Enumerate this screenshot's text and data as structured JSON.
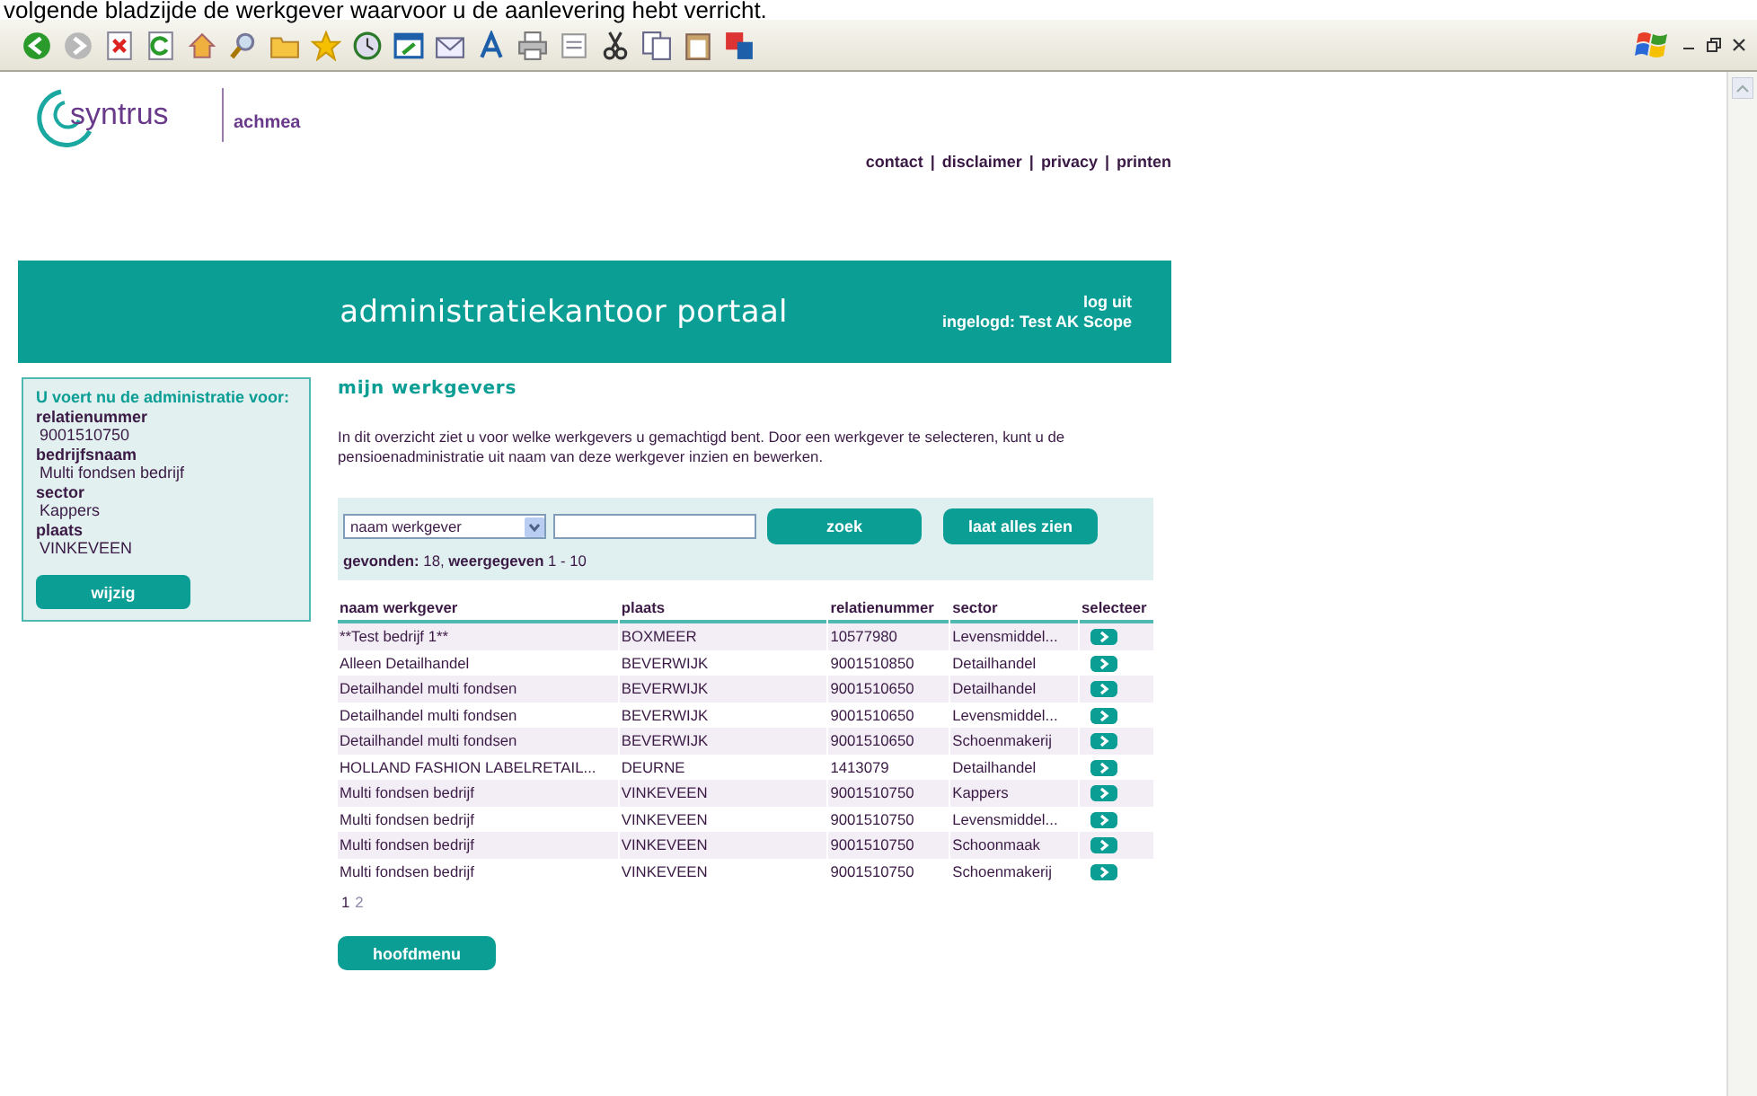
{
  "caption": "volgende bladzijde de werkgever waarvoor u de aanlevering hebt verricht.",
  "header": {
    "logo": {
      "name": "syntrus",
      "partner": "achmea"
    },
    "links": [
      "contact",
      "disclaimer",
      "privacy",
      "printen"
    ],
    "separator": "|"
  },
  "banner": {
    "title": "administratiekantoor portaal",
    "logout": "log uit",
    "logged_in": "ingelogd: Test AK Scope"
  },
  "sidebar": {
    "heading": "U voert nu de administratie voor:",
    "fields": [
      {
        "label": "relatienummer",
        "value": "9001510750"
      },
      {
        "label": "bedrijfsnaam",
        "value": "Multi fondsen bedrijf"
      },
      {
        "label": "sector",
        "value": "Kappers"
      },
      {
        "label": "plaats",
        "value": "VINKEVEEN"
      }
    ],
    "button": "wijzig"
  },
  "main": {
    "title": "mijn werkgevers",
    "intro": "In dit overzicht ziet u voor welke werkgevers u gemachtigd bent. Door een werkgever te selecteren, kunt u de pensioenadministratie uit naam van deze werkgever inzien en bewerken.",
    "search": {
      "field_select": "naam werkgever",
      "search_button": "zoek",
      "show_all_button": "laat alles zien",
      "result": "**gevonden:** 18, **weergegeven** 1 - 10"
    },
    "table": {
      "columns": [
        "naam werkgever",
        "plaats",
        "relatienummer",
        "sector",
        "selecteer"
      ],
      "rows": [
        [
          "**Test bedrijf 1**",
          "BOXMEER",
          "10577980",
          "Levensmiddel..."
        ],
        [
          "Alleen Detailhandel",
          "BEVERWIJK",
          "9001510850",
          "Detailhandel"
        ],
        [
          "Detailhandel multi fondsen",
          "BEVERWIJK",
          "9001510650",
          "Detailhandel"
        ],
        [
          "Detailhandel multi fondsen",
          "BEVERWIJK",
          "9001510650",
          "Levensmiddel..."
        ],
        [
          "Detailhandel multi fondsen",
          "BEVERWIJK",
          "9001510650",
          "Schoenmakerij"
        ],
        [
          "HOLLAND FASHION LABELRETAIL...",
          "DEURNE",
          "1413079",
          "Detailhandel"
        ],
        [
          "Multi fondsen bedrijf",
          "VINKEVEEN",
          "9001510750",
          "Kappers"
        ],
        [
          "Multi fondsen bedrijf",
          "VINKEVEEN",
          "9001510750",
          "Levensmiddel..."
        ],
        [
          "Multi fondsen bedrijf",
          "VINKEVEEN",
          "9001510750",
          "Schoonmaak"
        ],
        [
          "Multi fondsen bedrijf",
          "VINKEVEEN",
          "9001510750",
          "Schoenmakerij"
        ]
      ]
    },
    "pages": [
      {
        "label": "1",
        "selected": true
      },
      {
        "label": "2",
        "selected": false
      }
    ],
    "main_menu_button": "hoofdmenu"
  }
}
